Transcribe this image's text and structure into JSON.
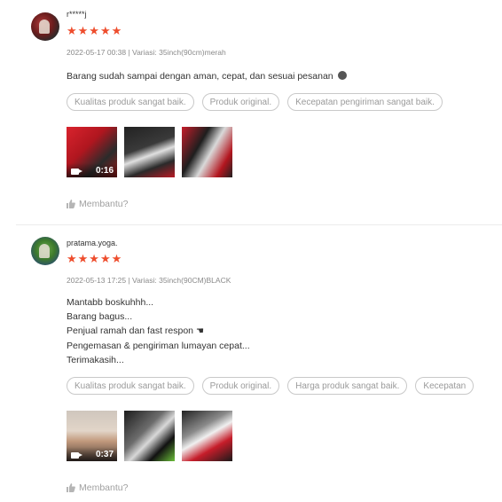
{
  "reviews": [
    {
      "username": "r*****j",
      "stars": "★★★★★",
      "meta": "2022-05-17 00:38 | Variasi: 35inch(90cm)merah",
      "comment_lines": [
        "Barang sudah sampai dengan aman, cepat, dan sesuai pesanan"
      ],
      "tags": [
        "Kualitas produk sangat baik.",
        "Produk original.",
        "Kecepatan pengiriman sangat baik."
      ],
      "video_duration": "0:16",
      "helpful_label": "Membantu?"
    },
    {
      "username": "pratama.yoga.",
      "stars": "★★★★★",
      "meta": "2022-05-13 17:25 | Variasi: 35inch(90CM)BLACK",
      "comment_lines": [
        "Mantabb boskuhhh...",
        "Barang bagus...",
        "Penjual ramah dan fast respon",
        "Pengemasan & pengiriman lumayan cepat...",
        "Terimakasih..."
      ],
      "tags": [
        "Kualitas produk sangat baik.",
        "Produk original.",
        "Harga produk sangat baik.",
        "Kecepatan"
      ],
      "video_duration": "0:37",
      "helpful_label": "Membantu?"
    }
  ],
  "colors": {
    "star": "#ee4d2d",
    "muted": "#8a8a8a",
    "tag_border": "#c9c9c9"
  },
  "icons": [
    "video-camera-icon",
    "thumbs-up-icon",
    "emoji-icon",
    "pointing-hand-icon"
  ]
}
